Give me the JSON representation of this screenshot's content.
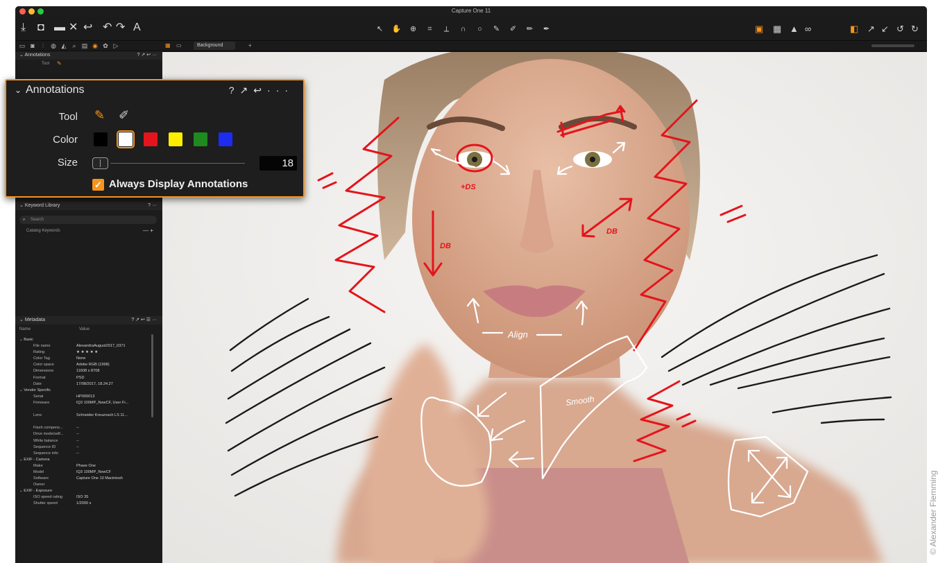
{
  "window": {
    "title": "Capture One 11"
  },
  "colors": {
    "accent": "#f7941d",
    "annotation_red": "#e4141c",
    "annotation_white": "#ffffff",
    "annotation_black": "#1a1a1a"
  },
  "toolbar": {
    "left_icons": [
      "import-icon",
      "camera-icon",
      "browser-icon",
      "close-icon",
      "undo-icon",
      "redo-icon",
      "text-icon"
    ],
    "cursor_tools": [
      "select",
      "pan",
      "zoom",
      "crop",
      "straighten",
      "keystone",
      "spot",
      "brush",
      "eraser",
      "gradient",
      "annotation"
    ],
    "right_icons": [
      "viewer-mode-icon",
      "browser-grid-icon",
      "exposure-warning-icon",
      "proof-icon",
      "edit-selected-icon",
      "copy-icon",
      "apply-icon",
      "reset-icon"
    ]
  },
  "viewer_bar": {
    "background_label": "Background",
    "add_label": "+"
  },
  "sidebar": {
    "annotations_header": "Annotations",
    "mini_tool_label": "Tool",
    "keyword_library": {
      "header": "Keyword Library",
      "search_placeholder": "Search",
      "catalog_label": "Catalog Keywords"
    },
    "metadata": {
      "header": "Metadata",
      "col_name": "Name",
      "col_value": "Value",
      "rows": [
        {
          "group": true,
          "k": "Basic",
          "v": ""
        },
        {
          "k": "File name",
          "v": "AlexandraAugust2017_0371"
        },
        {
          "k": "Rating",
          "v": "★ ★ ★ ★ ★"
        },
        {
          "k": "Color Tag",
          "v": "None"
        },
        {
          "k": "Color space",
          "v": "Adobe RGB (1998)"
        },
        {
          "k": "Dimensions",
          "v": "11608 x 8708"
        },
        {
          "k": "Format",
          "v": "PSD"
        },
        {
          "k": "Date",
          "v": "17/08/2017, 18.24.27"
        },
        {
          "group": true,
          "k": "Vendor Specific",
          "v": ""
        },
        {
          "k": "Serial",
          "v": "HP000013"
        },
        {
          "k": "Firmware",
          "v": "IQ3 100MP_NewCF, User Fi..."
        },
        {
          "k": "",
          "v": ""
        },
        {
          "k": "Lens",
          "v": "Schneider Kreuznach LS 11..."
        },
        {
          "k": "",
          "v": ""
        },
        {
          "k": "Flash compens...",
          "v": "--"
        },
        {
          "k": "Drive mode/self...",
          "v": "--"
        },
        {
          "k": "White balance",
          "v": "--"
        },
        {
          "k": "Sequence ID",
          "v": "--"
        },
        {
          "k": "Sequence info",
          "v": "--"
        },
        {
          "group": true,
          "k": "EXIF - Camera",
          "v": ""
        },
        {
          "k": "Make",
          "v": "Phase One"
        },
        {
          "k": "Model",
          "v": "IQ3 100MP_NewCF"
        },
        {
          "k": "Software",
          "v": "Capture One 10 Macintosh"
        },
        {
          "k": "Owner",
          "v": ""
        },
        {
          "group": true,
          "k": "EXIF - Exposure",
          "v": ""
        },
        {
          "k": "ISO speed rating",
          "v": "ISO 35"
        },
        {
          "k": "Shutter speed",
          "v": "1/2000 s"
        }
      ]
    }
  },
  "popup": {
    "title": "Annotations",
    "tool_label": "Tool",
    "color_label": "Color",
    "size_label": "Size",
    "size_value": "18",
    "always_display_label": "Always Display Annotations",
    "always_display_checked": true,
    "selected_color": "#ffffff",
    "colors": [
      "#000000",
      "#ffffff",
      "#e4141c",
      "#ffed00",
      "#1f8a1f",
      "#1c2cf0"
    ]
  },
  "annotations_text": {
    "ds_eye": "+DS",
    "db_left": "DB",
    "db_right": "DB",
    "align": "Align",
    "smooth": "Smooth"
  },
  "credit": "© Alexander Flemming"
}
